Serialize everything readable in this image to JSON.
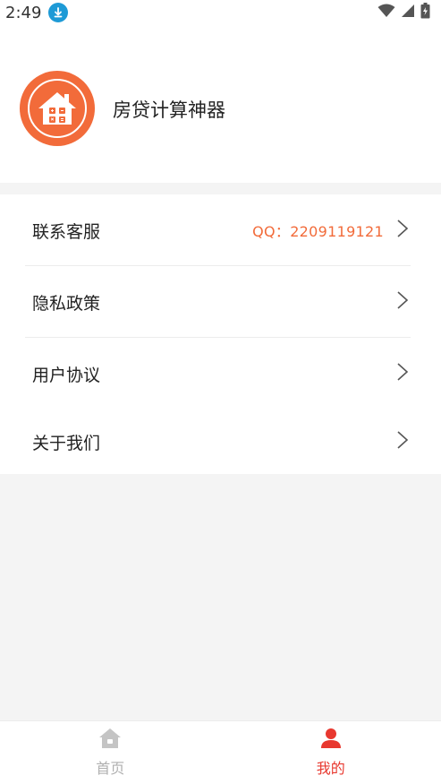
{
  "status_bar": {
    "time": "2:49",
    "download_icon": "download-icon",
    "wifi_icon": "wifi-icon",
    "signal_icon": "signal-icon",
    "battery_icon": "battery-charging-icon"
  },
  "profile": {
    "logo_icon": "house-calculator-icon",
    "app_name": "房贷计算神器"
  },
  "menu": {
    "items": [
      {
        "label": "联系客服",
        "value": "QQ：2209119121",
        "icon": "chevron-right-icon"
      },
      {
        "label": "隐私政策",
        "icon": "chevron-right-icon"
      },
      {
        "label": "用户协议",
        "icon": "chevron-right-icon"
      },
      {
        "label": "关于我们",
        "icon": "chevron-right-icon"
      }
    ]
  },
  "tabbar": {
    "tabs": [
      {
        "label": "首页",
        "icon": "home-icon",
        "active": false
      },
      {
        "label": "我的",
        "icon": "user-icon",
        "active": true
      }
    ]
  },
  "colors": {
    "accent": "#f26b3a",
    "active_tab": "#e8382f",
    "inactive_tab": "#b0b0b0",
    "background": "#f4f4f4"
  }
}
